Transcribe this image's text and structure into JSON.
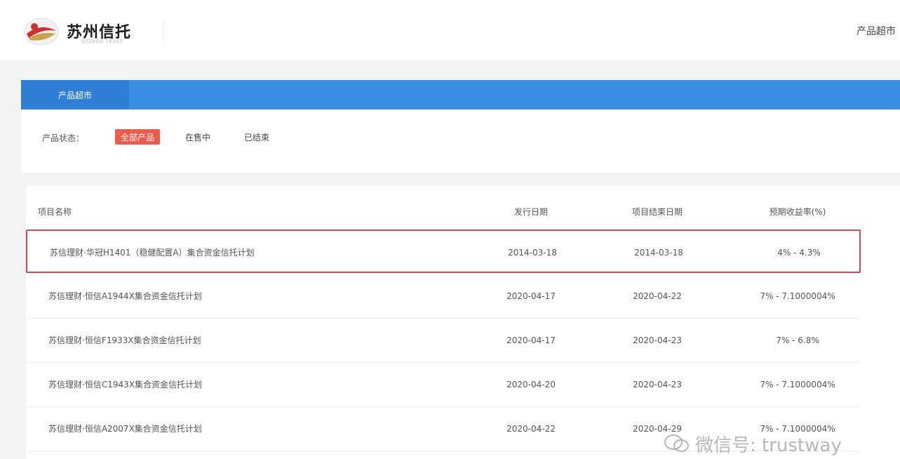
{
  "header": {
    "brand": "苏州信托",
    "brand_sub": "SUZHOU TRUST",
    "nav_label": "产品超市"
  },
  "tabs": {
    "active": "产品超市"
  },
  "filter": {
    "label": "产品状态：",
    "options": [
      "全部产品",
      "在售中",
      "已结束"
    ]
  },
  "table": {
    "headers": [
      "项目名称",
      "发行日期",
      "项目结束日期",
      "预期收益率(%)"
    ],
    "rows": [
      {
        "name": "苏信理财·华冠H1401（稳健配置A）集合资金信托计划",
        "issue": "2014-03-18",
        "end": "2014-03-18",
        "rate": "4% - 4.3%"
      },
      {
        "name": "苏信理财·恒信A1944X集合资金信托计划",
        "issue": "2020-04-17",
        "end": "2020-04-22",
        "rate": "7% - 7.1000004%"
      },
      {
        "name": "苏信理财·恒信F1933X集合资金信托计划",
        "issue": "2020-04-17",
        "end": "2020-04-23",
        "rate": "7% - 6.8%"
      },
      {
        "name": "苏信理财·恒信C1943X集合资金信托计划",
        "issue": "2020-04-20",
        "end": "2020-04-23",
        "rate": "7% - 7.1000004%"
      },
      {
        "name": "苏信理财·恒信A2007X集合资金信托计划",
        "issue": "2020-04-22",
        "end": "2020-04-29",
        "rate": "7% - 7.1000004%"
      }
    ]
  },
  "watermark": "微信号: trustway"
}
